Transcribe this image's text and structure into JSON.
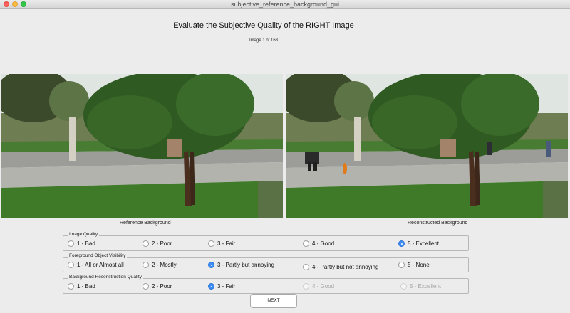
{
  "window": {
    "title": "subjective_reference_background_gui"
  },
  "header": {
    "title": "Evaluate the Subjective Quality of the RIGHT Image",
    "counter": "Image 1 of 168"
  },
  "images": {
    "left_caption": "Reference Background",
    "right_caption": "Reconstructed Background"
  },
  "image_quality": {
    "legend": "Image Quality",
    "options": [
      "1 - Bad",
      "2 - Poor",
      "3 - Fair",
      "4 - Good",
      "5 - Excellent"
    ],
    "selected": "5 - Excellent"
  },
  "foreground_visibility": {
    "legend": "Foreground Object Visibility",
    "options": [
      "1 - All or Almost all",
      "2 - Mostly",
      "3 - Partly but annoying",
      "4 - Partly but not annoying",
      "5 - None"
    ],
    "selected": "3 - Partly but annoying"
  },
  "background_reconstruction": {
    "legend": "Background Reconstruction Quality",
    "options": [
      "1 - Bad",
      "2 - Poor",
      "3 - Fair",
      "4 - Good",
      "5 - Excellent"
    ],
    "selected": "3 - Fair",
    "disabled_options": [
      "4 - Good",
      "5 - Excellent"
    ]
  },
  "actions": {
    "next_label": "NEXT"
  },
  "colors": {
    "radio_selected": "#3e8ef5",
    "window_background": "#ececec"
  }
}
